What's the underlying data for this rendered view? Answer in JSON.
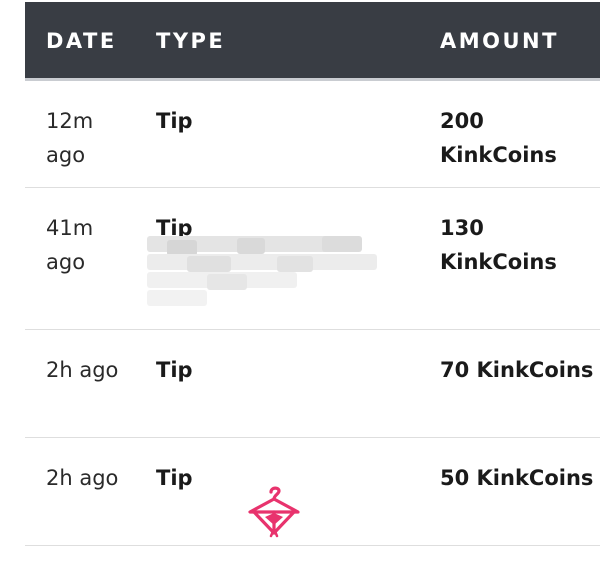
{
  "table": {
    "headers": {
      "date": "DATE",
      "type": "TYPE",
      "amount": "AMOUNT"
    },
    "rows": [
      {
        "date": "12m ago",
        "type": "Tip",
        "amount": "200 KinkCoins"
      },
      {
        "date": "41m ago",
        "type": "Tip",
        "amount": "130 KinkCoins"
      },
      {
        "date": "2h ago",
        "type": "Tip",
        "amount": "70 KinkCoins"
      },
      {
        "date": "2h ago",
        "type": "Tip",
        "amount": "50 KinkCoins"
      }
    ]
  },
  "colors": {
    "header_bg": "#393d44",
    "header_text": "#ffffff",
    "row_divider": "#dedede",
    "logo": "#e8336d"
  },
  "icons": {
    "logo": "hanger-bow-logo-icon",
    "redaction": "pixelated-blur"
  }
}
